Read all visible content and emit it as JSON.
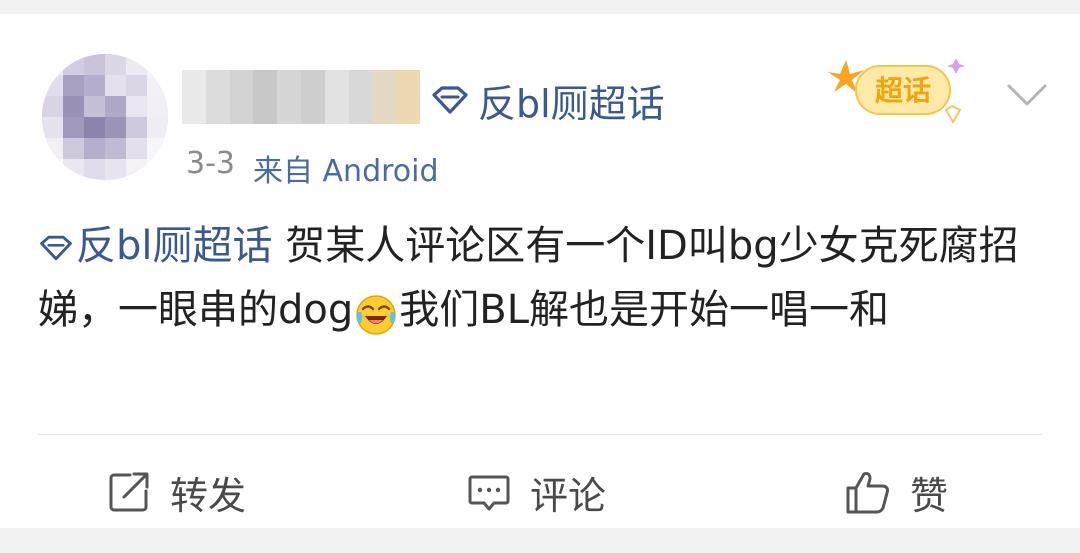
{
  "post": {
    "super_topic": "反bl厕超话",
    "date_fragment": "3-3",
    "source": "来自 Android",
    "content": {
      "topic": "反bl厕超话",
      "text_before_emoji": " 贺某人评论区有一个ID叫bg少女克死腐招娣，一眼串的dog",
      "text_after_emoji": "我们BL解也是开始一唱一和"
    },
    "badge_label": "超话"
  },
  "actions": {
    "repost_label": "转发",
    "comment_label": "评论",
    "like_label": "赞"
  },
  "colors": {
    "link": "#3a5a8f",
    "text": "#222222",
    "meta": "#8a8a8a",
    "badge_orange": "#f6a623"
  },
  "icons": {
    "topic": "diamond-icon",
    "menu": "chevron-down-icon",
    "emoji": "emoji-laugh-icon",
    "repost": "share-icon",
    "comment": "comment-icon",
    "like": "thumbs-up-icon"
  }
}
